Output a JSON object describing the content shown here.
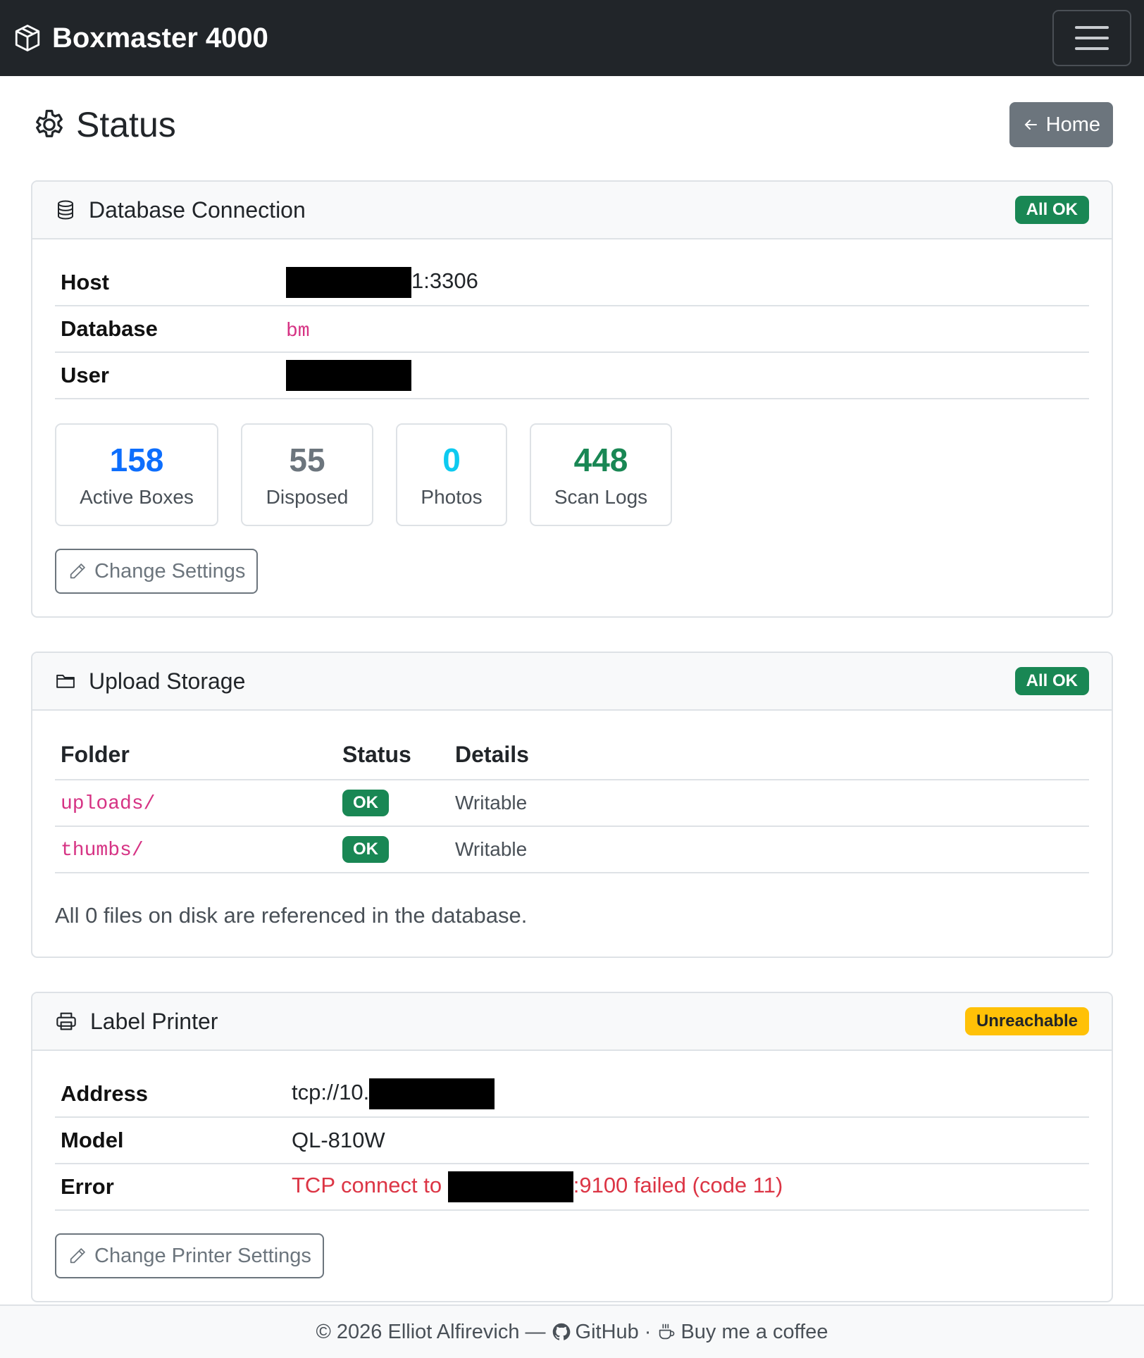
{
  "navbar": {
    "brand": "Boxmaster 4000",
    "icons": {
      "brand": "box-icon",
      "menu": "hamburger-icon"
    }
  },
  "page": {
    "title": "Status",
    "home_label": "Home"
  },
  "database": {
    "title": "Database Connection",
    "badge": "All OK",
    "rows": [
      {
        "key": "Host",
        "value_suffix": "1:3306"
      },
      {
        "key": "Database",
        "value": "bm"
      },
      {
        "key": "User"
      }
    ],
    "stats": [
      {
        "num": "158",
        "label": "Active Boxes",
        "color": "#0d6efd"
      },
      {
        "num": "55",
        "label": "Disposed",
        "color": "#6c757d"
      },
      {
        "num": "0",
        "label": "Photos",
        "color": "#0dcaf0"
      },
      {
        "num": "448",
        "label": "Scan Logs",
        "color": "#198754"
      }
    ],
    "button": "Change Settings"
  },
  "storage": {
    "title": "Upload Storage",
    "badge": "All OK",
    "headers": [
      "Folder",
      "Status",
      "Details"
    ],
    "rows": [
      {
        "folder": "uploads/",
        "status": "OK",
        "details": "Writable"
      },
      {
        "folder": "thumbs/",
        "status": "OK",
        "details": "Writable"
      }
    ],
    "note": "All 0 files on disk are referenced in the database."
  },
  "printer": {
    "title": "Label Printer",
    "badge": "Unreachable",
    "rows": [
      {
        "key": "Address",
        "value_prefix": "tcp://10."
      },
      {
        "key": "Model",
        "value": "QL-810W"
      },
      {
        "key": "Error",
        "value_prefix": "TCP connect to ",
        "value_suffix": ":9100 failed (code 11)"
      }
    ],
    "button": "Change Printer Settings"
  },
  "footer": {
    "copyright": "© 2026 Elliot Alfirevich —",
    "github": "GitHub",
    "separator": "·",
    "coffee": "Buy me a coffee"
  }
}
